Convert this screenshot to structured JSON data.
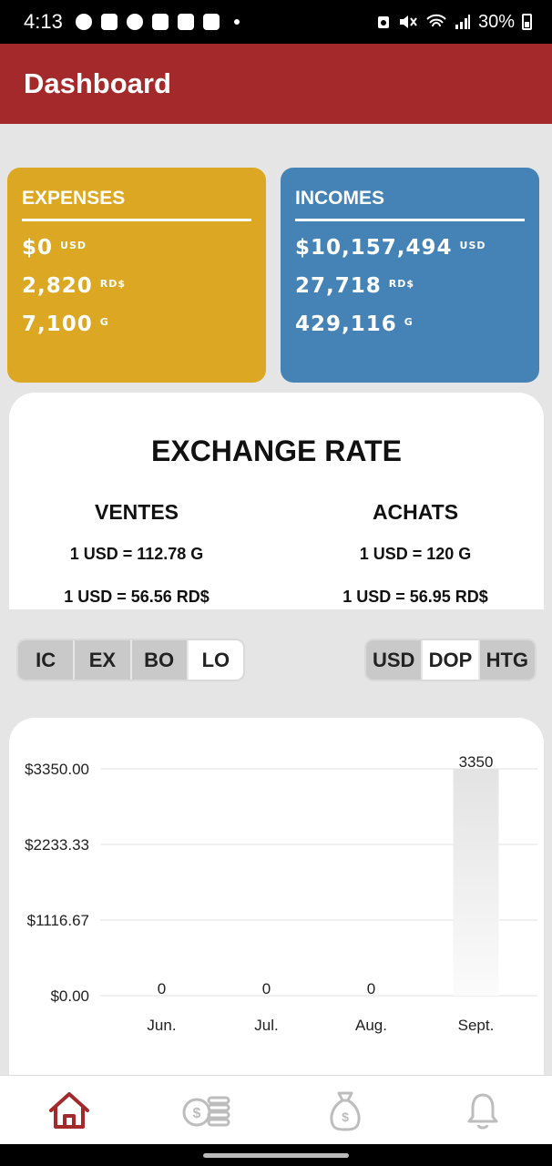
{
  "status_bar": {
    "time": "4:13",
    "battery": "30%"
  },
  "app_bar": {
    "title": "Dashboard"
  },
  "expenses": {
    "title": "EXPENSES",
    "rows": [
      {
        "value": "$0",
        "currency": "USD"
      },
      {
        "value": "2,820",
        "currency": "RD$"
      },
      {
        "value": "7,100",
        "currency": "G"
      }
    ]
  },
  "incomes": {
    "title": "INCOMES",
    "rows": [
      {
        "value": "$10,157,494",
        "currency": "USD"
      },
      {
        "value": "27,718",
        "currency": "RD$"
      },
      {
        "value": "429,116",
        "currency": "G"
      }
    ]
  },
  "exchange_rate": {
    "title": "EXCHANGE RATE",
    "ventes": {
      "title": "VENTES",
      "lines": [
        "1 USD = 112.78 G",
        "1 USD = 56.56 RD$"
      ]
    },
    "achats": {
      "title": "ACHATS",
      "lines": [
        "1 USD = 120 G",
        "1 USD = 56.95 RD$"
      ]
    }
  },
  "type_toggle": {
    "options": [
      "IC",
      "EX",
      "BO",
      "LO"
    ],
    "selected": "LO"
  },
  "currency_toggle": {
    "options": [
      "USD",
      "DOP",
      "HTG"
    ],
    "selected": "DOP"
  },
  "chart_data": {
    "type": "bar",
    "categories": [
      "Jun.",
      "Jul.",
      "Aug.",
      "Sept."
    ],
    "values": [
      0,
      0,
      0,
      3350
    ],
    "data_labels": [
      "0",
      "0",
      "0",
      "3350"
    ],
    "y_ticks": [
      "$0.00",
      "$1116.67",
      "$2233.33",
      "$3350.00"
    ],
    "ylim": [
      0,
      3350
    ],
    "grid": true,
    "bar_color": "#e6e6e6"
  },
  "bottom_nav": {
    "items": [
      "home-icon",
      "coins-icon",
      "money-bag-icon",
      "bell-icon"
    ],
    "active": "home-icon"
  },
  "colors": {
    "primary": "#a4292b",
    "expenses": "#dca722",
    "incomes": "#4583b6"
  }
}
